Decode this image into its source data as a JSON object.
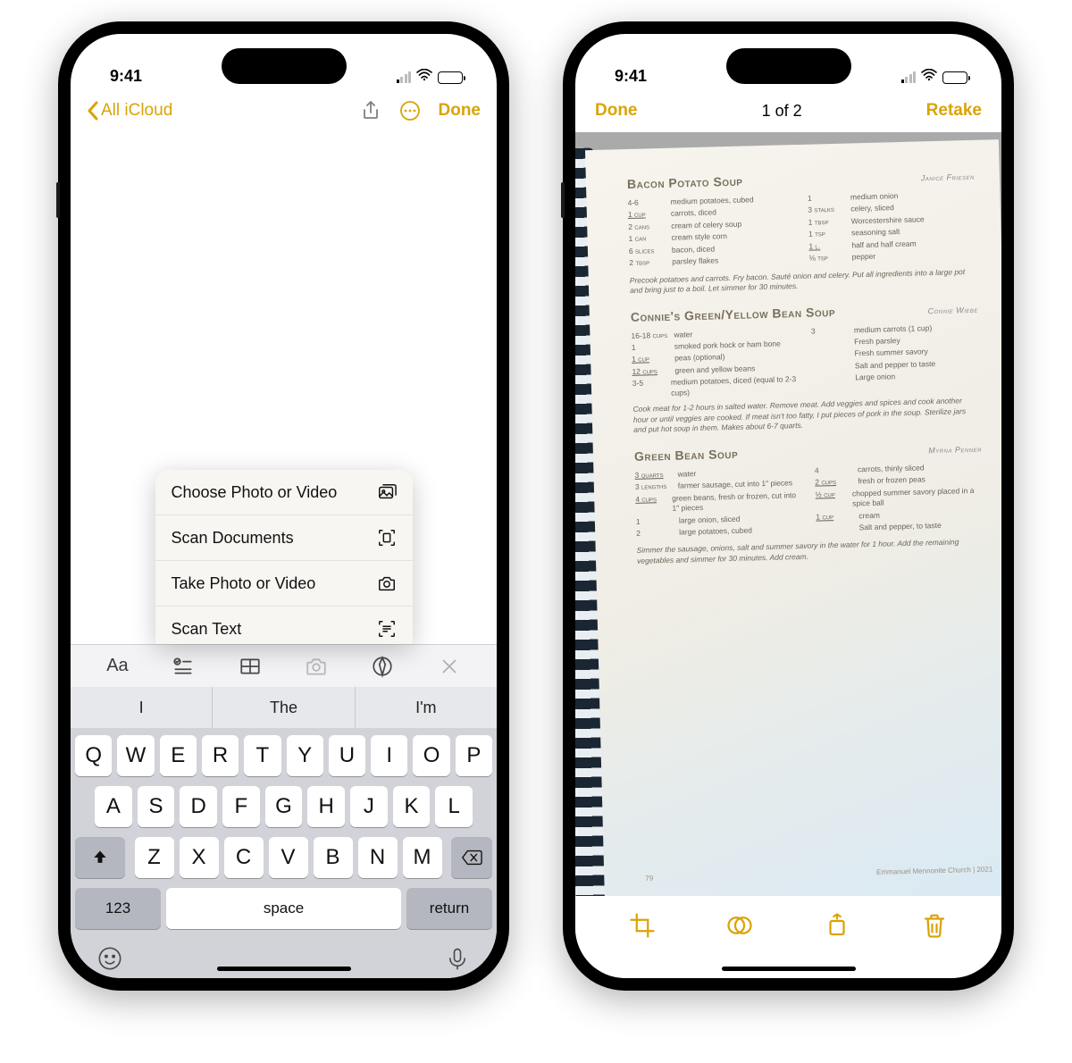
{
  "status": {
    "time": "9:41"
  },
  "left": {
    "back_label": "All iCloud",
    "done_label": "Done",
    "menu": {
      "choose": "Choose Photo or Video",
      "scan_docs": "Scan Documents",
      "take": "Take Photo or Video",
      "scan_text": "Scan Text"
    },
    "predictions": [
      "I",
      "The",
      "I'm"
    ],
    "keys": {
      "r1": [
        "Q",
        "W",
        "E",
        "R",
        "T",
        "Y",
        "U",
        "I",
        "O",
        "P"
      ],
      "r2": [
        "A",
        "S",
        "D",
        "F",
        "G",
        "H",
        "J",
        "K",
        "L"
      ],
      "r3": [
        "Z",
        "X",
        "C",
        "V",
        "B",
        "N",
        "M"
      ],
      "num": "123",
      "space": "space",
      "return": "return"
    }
  },
  "right": {
    "done": "Done",
    "counter": "1 of 2",
    "retake": "Retake",
    "page": {
      "page_num": "79",
      "imprint": "Emmanuel Mennonite Church  |  2021",
      "recipes": [
        {
          "title": "Bacon Potato Soup",
          "author": "Janice Friesen",
          "col1": [
            {
              "q": "4-6",
              "t": "medium potatoes, cubed"
            },
            {
              "q": "1 cup",
              "u": true,
              "t": "carrots, diced"
            },
            {
              "q": "2 cans",
              "t": "cream of celery soup"
            },
            {
              "q": "1 can",
              "t": "cream style corn"
            },
            {
              "q": "6 slices",
              "t": "bacon, diced"
            },
            {
              "q": "2 tbsp",
              "t": "parsley flakes"
            }
          ],
          "col2": [
            {
              "q": "1",
              "t": "medium onion"
            },
            {
              "q": "3 stalks",
              "t": "celery, sliced"
            },
            {
              "q": "1 tbsp",
              "t": "Worcestershire sauce"
            },
            {
              "q": "1 tsp",
              "t": "seasoning salt"
            },
            {
              "q": "1 l.",
              "u": true,
              "t": "half and half cream"
            },
            {
              "q": "⅛ tsp",
              "t": "pepper"
            }
          ],
          "instr": "Precook potatoes and carrots. Fry bacon. Sauté onion and celery. Put all ingredients into a large pot and bring just to a boil. Let simmer for 30 minutes."
        },
        {
          "title": "Connie's Green/Yellow Bean Soup",
          "author": "Connie Wiebe",
          "col1": [
            {
              "q": "16-18 cups",
              "t": "water"
            },
            {
              "q": "1",
              "t": "smoked pork hock or ham bone"
            },
            {
              "q": "1 cup",
              "u": true,
              "t": "peas (optional)"
            },
            {
              "q": "12 cups",
              "u": true,
              "t": "green and yellow beans"
            },
            {
              "q": "3-5",
              "t": "medium potatoes, diced (equal to 2-3 cups)"
            }
          ],
          "col2": [
            {
              "q": "3",
              "t": "medium carrots (1 cup)"
            },
            {
              "q": "",
              "t": "Fresh parsley"
            },
            {
              "q": "",
              "t": "Fresh summer savory"
            },
            {
              "q": "",
              "t": "Salt and pepper to taste"
            },
            {
              "q": "",
              "t": "Large onion"
            }
          ],
          "instr": "Cook meat for 1-2 hours in salted water. Remove meat. Add veggies and spices and cook another hour or until veggies are cooked. If meat isn't too fatty, I put pieces of pork in the soup. Sterilize jars and put hot soup in them. Makes about 6-7 quarts."
        },
        {
          "title": "Green Bean Soup",
          "author": "Myrna Penner",
          "col1": [
            {
              "q": "3 quarts",
              "u": true,
              "t": "water"
            },
            {
              "q": "3 lengths",
              "t": "farmer sausage, cut into 1″ pieces"
            },
            {
              "q": "4 cups",
              "u": true,
              "t": "green beans, fresh or frozen, cut into 1″ pieces"
            },
            {
              "q": "1",
              "t": "large onion, sliced"
            },
            {
              "q": "2",
              "t": "large potatoes, cubed"
            }
          ],
          "col2": [
            {
              "q": "4",
              "t": "carrots, thinly sliced"
            },
            {
              "q": "2 cups",
              "u": true,
              "t": "fresh or frozen peas"
            },
            {
              "q": "½ cup",
              "u": true,
              "t": "chopped summer savory placed in a spice ball"
            },
            {
              "q": "1 cup",
              "u": true,
              "t": "cream"
            },
            {
              "q": "",
              "t": "Salt and pepper, to taste"
            }
          ],
          "instr": "Simmer the sausage, onions, salt and summer savory in the water for 1 hour. Add the remaining vegetables and simmer for 30 minutes. Add cream."
        }
      ]
    }
  }
}
